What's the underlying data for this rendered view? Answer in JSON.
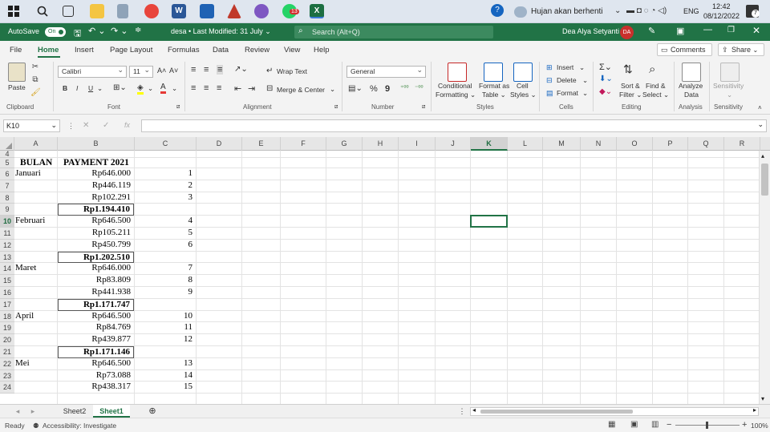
{
  "taskbar": {
    "weather_text": "Hujan akan berhenti",
    "language": "ENG",
    "time": "12:42",
    "date": "08/12/2022",
    "notification_count": "7",
    "badge_count": "13"
  },
  "titlebar": {
    "autosave_label": "AutoSave",
    "autosave_state": "On",
    "document_title": "desa • Last Modified: 31 July ⌄",
    "search_placeholder": "Search (Alt+Q)",
    "user_name": "Dea Alya Setyanti",
    "user_initials": "DA"
  },
  "menu": {
    "items": [
      "File",
      "Home",
      "Insert",
      "Page Layout",
      "Formulas",
      "Data",
      "Review",
      "View",
      "Help"
    ],
    "active": "Home",
    "comments_label": "Comments",
    "share_label": "Share"
  },
  "ribbon": {
    "clipboard": {
      "paste": "Paste",
      "group": "Clipboard"
    },
    "font": {
      "name": "Calibri",
      "size": "11",
      "group": "Font",
      "bold": "B",
      "italic": "I",
      "underline": "U"
    },
    "alignment": {
      "wrap_text": "Wrap Text",
      "merge_center": "Merge & Center",
      "group": "Alignment"
    },
    "number": {
      "format": "General",
      "group": "Number",
      "percent": "%",
      "comma": "9"
    },
    "styles": {
      "conditional_1": "Conditional",
      "conditional_2": "Formatting ⌄",
      "format_table_1": "Format as",
      "format_table_2": "Table ⌄",
      "cell_styles_1": "Cell",
      "cell_styles_2": "Styles ⌄",
      "group": "Styles"
    },
    "cells": {
      "insert": "Insert",
      "delete": "Delete",
      "format": "Format",
      "group": "Cells"
    },
    "editing": {
      "sort_1": "Sort &",
      "sort_2": "Filter ⌄",
      "find_1": "Find &",
      "find_2": "Select ⌄",
      "group": "Editing"
    },
    "analysis": {
      "analyze_1": "Analyze",
      "analyze_2": "Data",
      "group": "Analysis"
    },
    "sensitivity": {
      "label": "Sensitivity",
      "group": "Sensitivity"
    }
  },
  "formula_bar": {
    "name_box": "K10",
    "fx": "fx",
    "value": ""
  },
  "grid": {
    "columns": [
      "A",
      "B",
      "C",
      "D",
      "E",
      "F",
      "G",
      "H",
      "I",
      "J",
      "K",
      "L",
      "M",
      "N",
      "O",
      "P",
      "Q",
      "R"
    ],
    "selected_column": "K",
    "rows": [
      "4",
      "5",
      "6",
      "7",
      "8",
      "9",
      "10",
      "11",
      "12",
      "13",
      "14",
      "15",
      "16",
      "17",
      "18",
      "19",
      "20",
      "21",
      "22",
      "23",
      "24"
    ],
    "selected_row": "10",
    "headers": {
      "A": "BULAN",
      "B": "PAYMENT 2021"
    },
    "data_rows": [
      {
        "row": "6",
        "month": "Januari",
        "payment": "Rp646.000",
        "no": "1"
      },
      {
        "row": "7",
        "month": "",
        "payment": "Rp446.119",
        "no": "2"
      },
      {
        "row": "8",
        "month": "",
        "payment": "Rp102.291",
        "no": "3"
      },
      {
        "row": "9",
        "month": "",
        "payment": "Rp1.194.410",
        "no": "",
        "total": true
      },
      {
        "row": "10",
        "month": "Februari",
        "payment": "Rp646.500",
        "no": "4"
      },
      {
        "row": "11",
        "month": "",
        "payment": "Rp105.211",
        "no": "5"
      },
      {
        "row": "12",
        "month": "",
        "payment": "Rp450.799",
        "no": "6"
      },
      {
        "row": "13",
        "month": "",
        "payment": "Rp1.202.510",
        "no": "",
        "total": true
      },
      {
        "row": "14",
        "month": "Maret",
        "payment": "Rp646.000",
        "no": "7"
      },
      {
        "row": "15",
        "month": "",
        "payment": "Rp83.809",
        "no": "8"
      },
      {
        "row": "16",
        "month": "",
        "payment": "Rp441.938",
        "no": "9"
      },
      {
        "row": "17",
        "month": "",
        "payment": "Rp1.171.747",
        "no": "",
        "total": true
      },
      {
        "row": "18",
        "month": "April",
        "payment": "Rp646.500",
        "no": "10"
      },
      {
        "row": "19",
        "month": "",
        "payment": "Rp84.769",
        "no": "11"
      },
      {
        "row": "20",
        "month": "",
        "payment": "Rp439.877",
        "no": "12"
      },
      {
        "row": "21",
        "month": "",
        "payment": "Rp1.171.146",
        "no": "",
        "total": true
      },
      {
        "row": "22",
        "month": "Mei",
        "payment": "Rp646.500",
        "no": "13"
      },
      {
        "row": "23",
        "month": "",
        "payment": "Rp73.088",
        "no": "14"
      },
      {
        "row": "24",
        "month": "",
        "payment": "Rp438.317",
        "no": "15"
      }
    ]
  },
  "sheets": {
    "tabs": [
      "Sheet2",
      "Sheet1"
    ],
    "active": "Sheet1"
  },
  "status": {
    "ready": "Ready",
    "accessibility": "Accessibility: Investigate",
    "zoom": "100%"
  },
  "colors": {
    "excel_green": "#217346",
    "selection_border": "#217346",
    "avatar_red": "#c9302c"
  }
}
